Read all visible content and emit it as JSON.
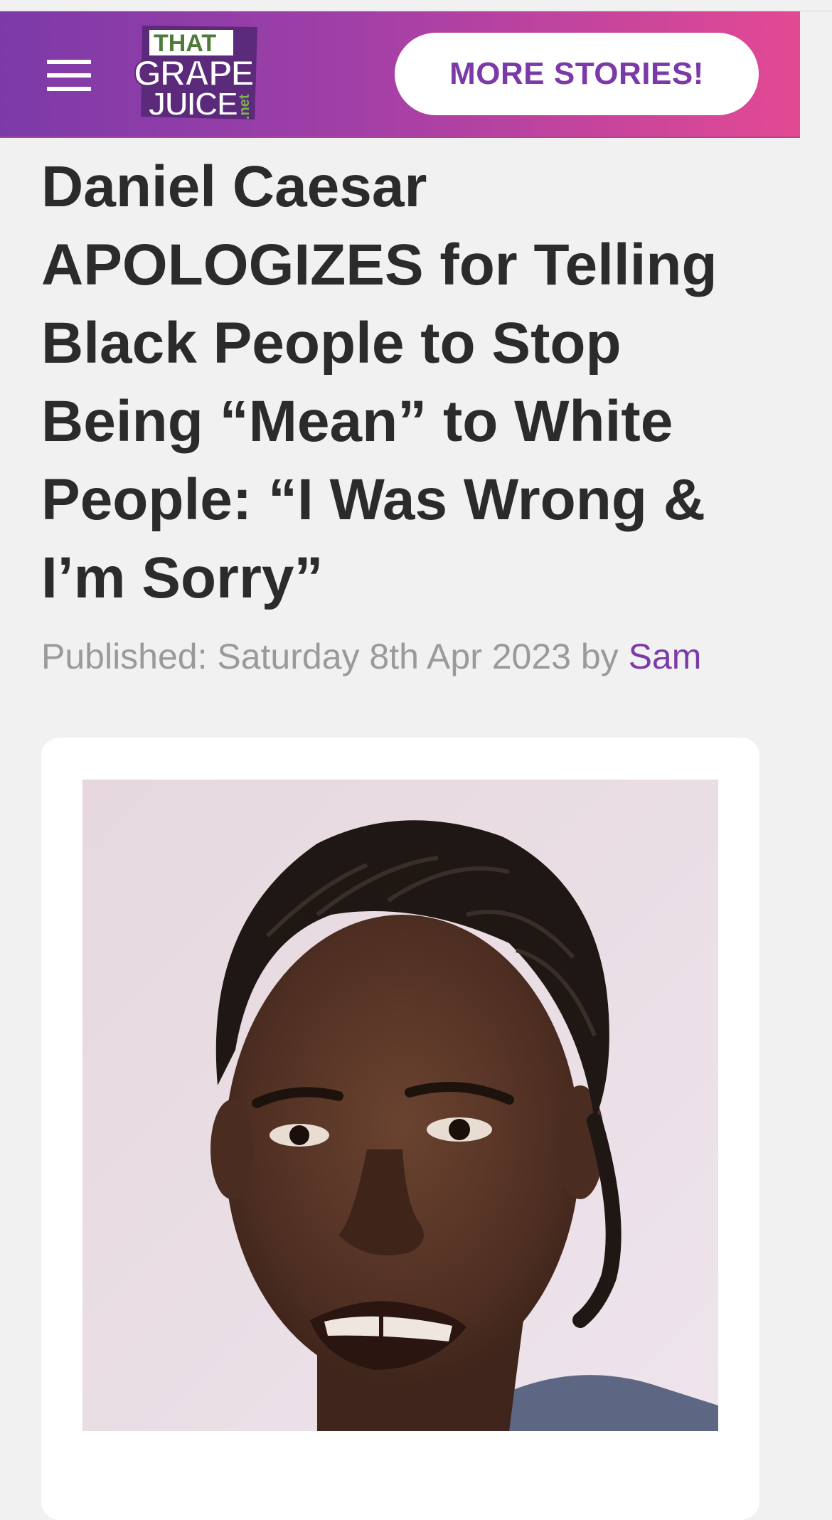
{
  "header": {
    "menu_icon": "hamburger-menu-icon",
    "logo": {
      "line1": "THAT",
      "line2": "GRAPE",
      "line3": "JUICE",
      "suffix": ".net"
    },
    "more_stories_label": "MORE STORIES!",
    "colors": {
      "gradient_start": "#7c3aa8",
      "gradient_end": "#e34993",
      "button_text": "#7c3aa8"
    }
  },
  "article": {
    "title": "Daniel Caesar APOLOGIZES for Telling Black People to Stop Being “Mean” to White People: “I Was Wrong & I’m Sorry”",
    "published_prefix": "Published: Saturday 8th Apr 2023 by ",
    "author": "Sam",
    "author_color": "#7c3aa8",
    "hero_image": "portrait-photo"
  }
}
